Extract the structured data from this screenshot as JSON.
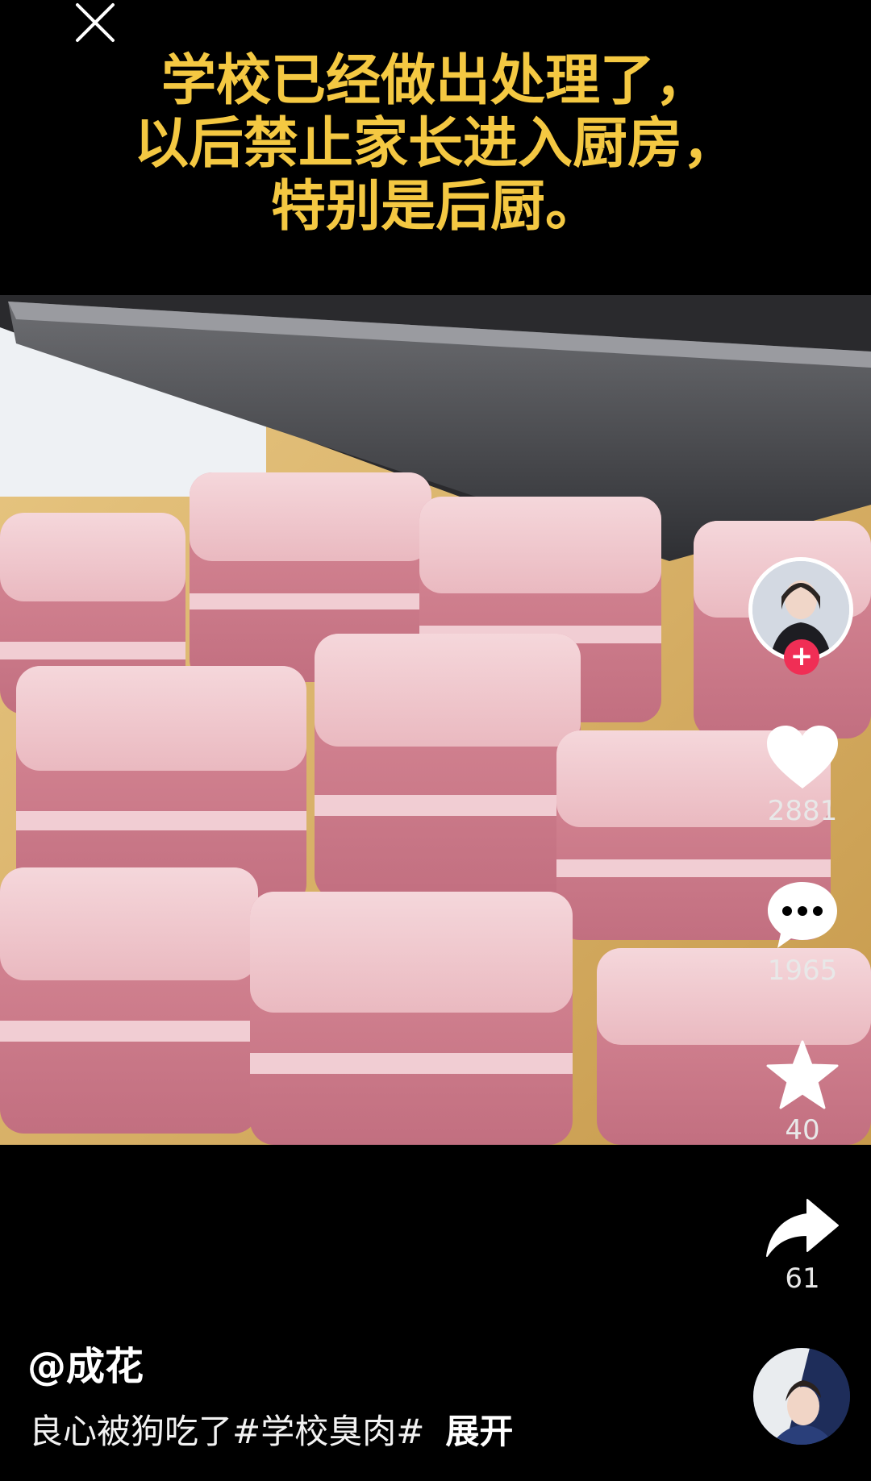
{
  "caption": {
    "line1": "学校已经做出处理了，",
    "line2": "以后禁止家长进入厨房，",
    "line3": "特别是后厨。"
  },
  "actions": {
    "likes": "2881",
    "comments": "1965",
    "favorites": "40",
    "shares": "61"
  },
  "post": {
    "author": "@成花",
    "description": "良心被狗吃了#学校臭肉#",
    "expand_label": "展开"
  },
  "icons": {
    "close": "close-icon",
    "follow": "plus-icon",
    "like": "heart-icon",
    "comment": "comment-bubble-icon",
    "favorite": "star-icon",
    "share": "share-arrow-icon"
  },
  "colors": {
    "caption_text": "#f4c842",
    "follow_badge": "#f02e55",
    "background": "#000000"
  }
}
